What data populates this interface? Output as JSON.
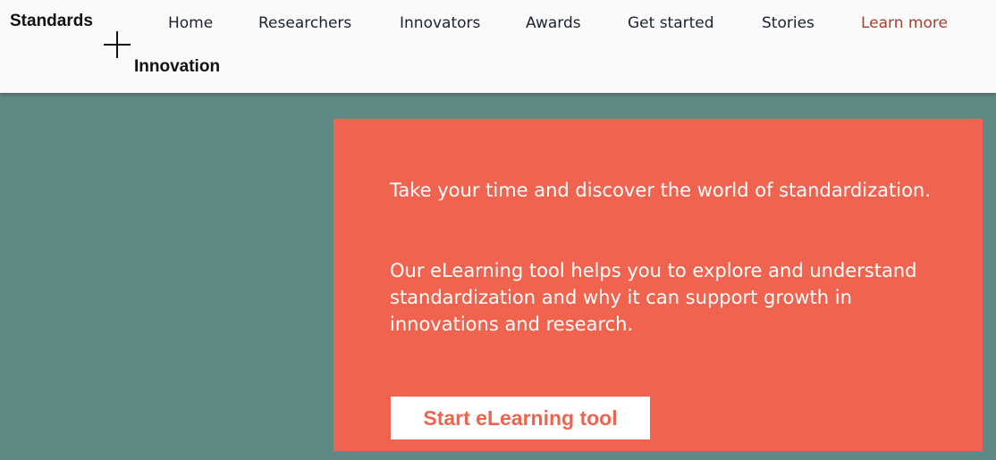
{
  "colors": {
    "page_background": "#5f8985",
    "header_background": "#fafafa",
    "card_background": "#f0644f",
    "accent_link": "#a5402e",
    "nav_text": "#1b2330",
    "cta_text": "#f0644f"
  },
  "logo": {
    "top_text": "Standards",
    "bottom_text": "Innovation",
    "mark_icon": "plus-icon"
  },
  "nav": {
    "items": [
      {
        "label": "Home"
      },
      {
        "label": "Researchers"
      },
      {
        "label": "Innovators"
      },
      {
        "label": "Awards"
      },
      {
        "label": "Get started"
      },
      {
        "label": "Stories"
      },
      {
        "label": "Learn more",
        "active": true
      }
    ]
  },
  "hero": {
    "paragraph_1": "Take your time and discover the world of standardization.",
    "paragraph_2": "Our eLearning tool helps you to explore and understand standardization and why it can support growth in innovations and research.",
    "cta_label": "Start eLearning tool"
  }
}
